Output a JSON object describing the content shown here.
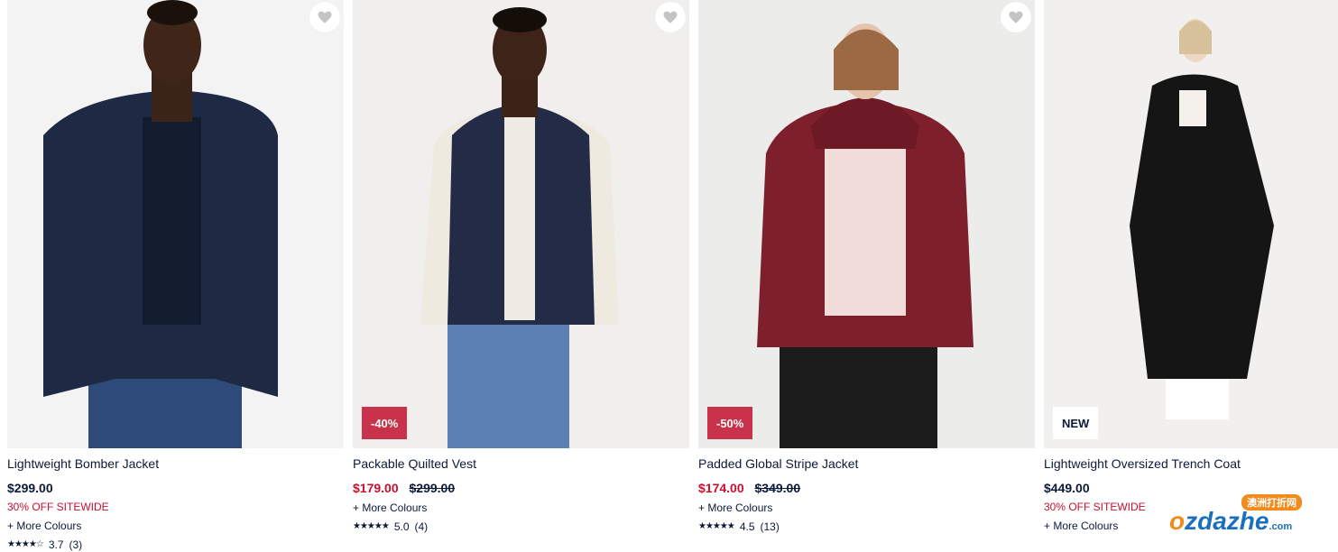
{
  "products": [
    {
      "name": "Lightweight Bomber Jacket",
      "price": "$299.00",
      "promo": "30% OFF SITEWIDE",
      "colours": "+ More Colours",
      "rating": "3.7",
      "reviews": "(3)",
      "stars": "★★★★☆"
    },
    {
      "name": "Packable Quilted Vest",
      "badge": "-40%",
      "price": "$179.00",
      "original_price": "$299.00",
      "colours": "+ More Colours",
      "rating": "5.0",
      "reviews": "(4)",
      "stars": "★★★★★"
    },
    {
      "name": "Padded Global Stripe Jacket",
      "badge": "-50%",
      "price": "$174.00",
      "original_price": "$349.00",
      "colours": "+ More Colours",
      "rating": "4.5",
      "reviews": "(13)",
      "stars": "★★★★★"
    },
    {
      "name": "Lightweight Oversized Trench Coat",
      "badge": "NEW",
      "price": "$449.00",
      "promo": "30% OFF SITEWIDE",
      "colours": "+ More Colours"
    }
  ],
  "watermark": {
    "top": "澳洲打折网",
    "main_o": "o",
    "main": "zdazhe",
    "suffix": ".com"
  },
  "colors": {
    "sale_red": "#c8324b",
    "price_red": "#c8102e",
    "navy": "#0b1a3a"
  },
  "icons": {
    "favorite": "heart-icon"
  }
}
